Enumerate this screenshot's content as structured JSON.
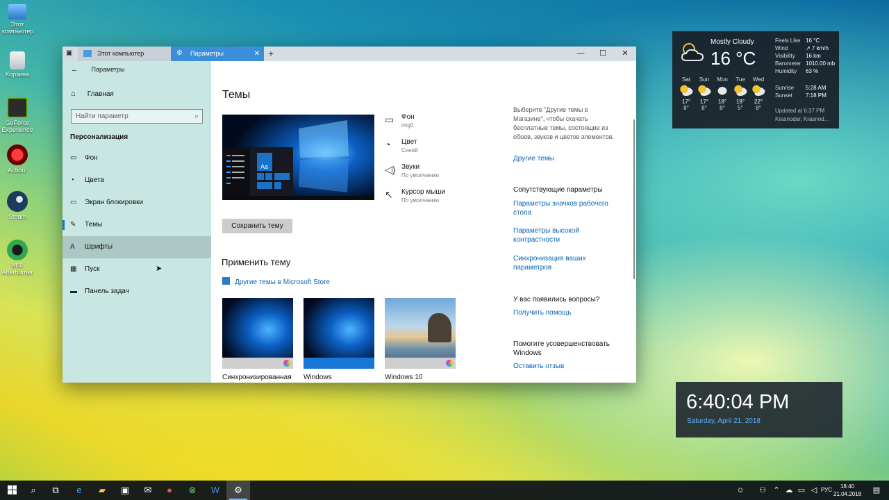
{
  "desktop": {
    "icons": [
      {
        "label": "Этот компьютер"
      },
      {
        "label": "Корзина"
      },
      {
        "label": "GeForce Experience"
      },
      {
        "label": "Action!"
      },
      {
        "label": "Steam"
      },
      {
        "label": "MSI Afterburner"
      }
    ]
  },
  "window": {
    "tabs": [
      {
        "label": "Этот компьютер",
        "active": false
      },
      {
        "label": "Параметры",
        "active": true
      }
    ],
    "new_tab": "+",
    "controls": {
      "minimize": "—",
      "maximize": "☐",
      "close": "✕"
    }
  },
  "sidebar": {
    "app_title": "Параметры",
    "home": "Главная",
    "search_placeholder": "Найти параметр",
    "section": "Персонализация",
    "items": [
      {
        "label": "Фон",
        "icon": "image-icon"
      },
      {
        "label": "Цвета",
        "icon": "palette-icon"
      },
      {
        "label": "Экран блокировки",
        "icon": "lock-screen-icon"
      },
      {
        "label": "Темы",
        "icon": "brush-icon",
        "active": true
      },
      {
        "label": "Шрифты",
        "icon": "fonts-icon",
        "hover": true
      },
      {
        "label": "Пуск",
        "icon": "start-icon"
      },
      {
        "label": "Панель задач",
        "icon": "taskbar-icon"
      }
    ]
  },
  "content": {
    "title": "Темы",
    "preview_tile_label": "Aa",
    "save_button": "Сохранить тему",
    "properties": [
      {
        "title": "Фон",
        "sub": "img0"
      },
      {
        "title": "Цвет",
        "sub": "Синий"
      },
      {
        "title": "Звуки",
        "sub": "По умолчанию"
      },
      {
        "title": "Курсор мыши",
        "sub": "По умолчанию"
      }
    ],
    "apply_title": "Применить тему",
    "store_link": "Другие темы в Microsoft Store",
    "themes": [
      {
        "label": "Синхронизированная"
      },
      {
        "label": "Windows"
      },
      {
        "label": "Windows 10"
      }
    ],
    "right": {
      "desc": "Выберите \"Другие темы в Магазине\", чтобы скачать бесплатные темы, состоящие из обоев, звуков и цветов элементов.",
      "more_themes": "Другие темы",
      "related_title": "Сопутствующие параметры",
      "related_links": [
        "Параметры значков рабочего стола",
        "Параметры высокой контрастности",
        "Синхронизация ваших параметров"
      ],
      "questions_title": "У вас появились вопросы?",
      "help_link": "Получить помощь",
      "improve_title": "Помогите усовершенствовать Windows",
      "feedback_link": "Оставить отзыв"
    }
  },
  "weather": {
    "condition": "Mostly Cloudy",
    "temperature": "16 °C",
    "details": [
      {
        "label": "Feels Like",
        "value": "16 °C"
      },
      {
        "label": "Wind",
        "value": "↗ 7 km/h"
      },
      {
        "label": "Visibility",
        "value": "16 km"
      },
      {
        "label": "Barometer",
        "value": "1010.00 mb"
      },
      {
        "label": "Humidity",
        "value": "63 %"
      }
    ],
    "forecast": [
      {
        "day": "Sat",
        "hi": "17°",
        "lo": "8°"
      },
      {
        "day": "Sun",
        "hi": "17°",
        "lo": "8°"
      },
      {
        "day": "Mon",
        "hi": "18°",
        "lo": "8°"
      },
      {
        "day": "Tue",
        "hi": "19°",
        "lo": "5°"
      },
      {
        "day": "Wed",
        "hi": "22°",
        "lo": "8°"
      }
    ],
    "sunrise_label": "Sunrise",
    "sunrise": "5:28 AM",
    "sunset_label": "Sunset",
    "sunset": "7:18 PM",
    "updated": "Updated at 6:37 PM",
    "location": "Krasnodar, Krasnod..."
  },
  "clock_widget": {
    "time": "6:40:04 PM",
    "date": "Saturday, April 21, 2018"
  },
  "taskbar": {
    "language": "РУС",
    "time": "18:40",
    "date": "21.04.2018"
  },
  "colors": {
    "accent": "#0a64b8",
    "active_tab": "#3a8fd8",
    "sidebar_bg": "#c4e4e0",
    "clock_date": "#5fb0ff"
  }
}
